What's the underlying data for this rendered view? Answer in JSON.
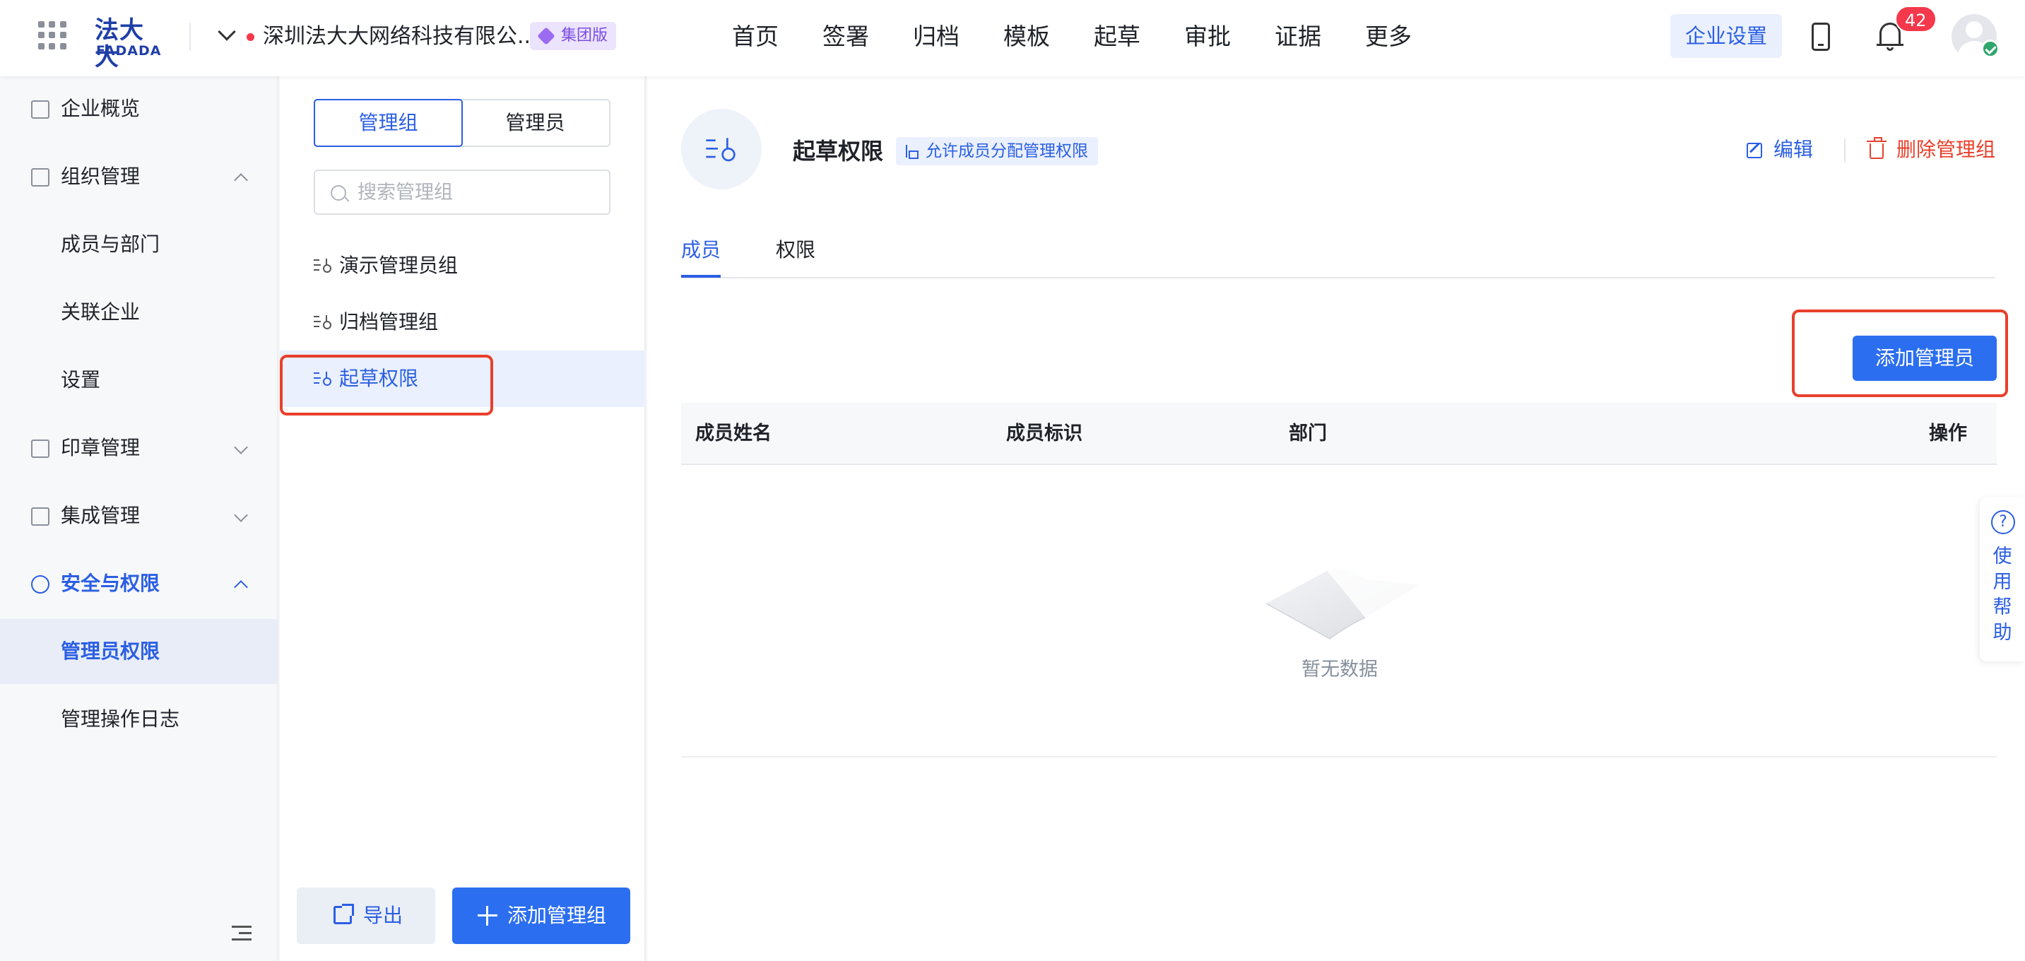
{
  "header": {
    "logo_cn": "法大大",
    "logo_en": "FADADA",
    "org_name": "深圳法大大网络科技有限公...",
    "org_badge": "集团版",
    "nav": [
      "首页",
      "签署",
      "归档",
      "模板",
      "起草",
      "审批",
      "证据",
      "更多"
    ],
    "enterprise_settings": "企业设置",
    "notification_count": "42",
    "icons": [
      "apps-grid-icon",
      "chevron-down-icon",
      "mobile-icon",
      "bell-icon",
      "avatar",
      "verified-icon"
    ]
  },
  "sidebar": {
    "items": [
      {
        "label": "企业概览",
        "icon": "dashboard-icon"
      },
      {
        "label": "组织管理",
        "icon": "org-icon",
        "expanded": true
      },
      {
        "label": "成员与部门"
      },
      {
        "label": "关联企业"
      },
      {
        "label": "设置"
      },
      {
        "label": "印章管理",
        "icon": "seal-icon",
        "expanded": false
      },
      {
        "label": "集成管理",
        "icon": "layers-icon",
        "expanded": false
      },
      {
        "label": "安全与权限",
        "icon": "key-icon",
        "expanded": true
      },
      {
        "label": "管理员权限",
        "selected": true
      },
      {
        "label": "管理操作日志"
      }
    ]
  },
  "groups_panel": {
    "segments": [
      "管理组",
      "管理员"
    ],
    "active_segment": "管理组",
    "search_placeholder": "搜索管理组",
    "groups": [
      "演示管理员组",
      "归档管理组",
      "起草权限"
    ],
    "selected_group": "起草权限",
    "export_label": "导出",
    "add_group_label": "添加管理组"
  },
  "detail": {
    "title": "起草权限",
    "tag": "允许成员分配管理权限",
    "edit_label": "编辑",
    "delete_label": "删除管理组",
    "tabs": [
      "成员",
      "权限"
    ],
    "active_tab": "成员",
    "add_admin_label": "添加管理员",
    "columns": [
      "成员姓名",
      "成员标识",
      "部门",
      "操作"
    ],
    "empty_text": "暂无数据"
  },
  "help": {
    "icon": "?",
    "label": "使用帮助"
  },
  "colors": {
    "accent": "#2b5fe3",
    "danger": "#e8402c",
    "badge": "#f5384b"
  }
}
